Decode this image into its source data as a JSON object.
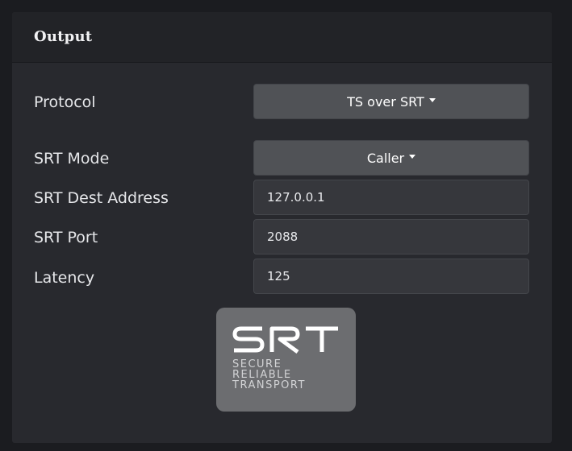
{
  "panel": {
    "title": "Output"
  },
  "fields": {
    "protocol": {
      "label": "Protocol",
      "value": "TS over SRT"
    },
    "srt_mode": {
      "label": "SRT Mode",
      "value": "Caller"
    },
    "dest_address": {
      "label": "SRT Dest Address",
      "value": "127.0.0.1"
    },
    "port": {
      "label": "SRT Port",
      "value": "2088"
    },
    "latency": {
      "label": "Latency",
      "value": "125"
    }
  },
  "logo": {
    "mark": "SRT",
    "tagline": [
      "SECURE",
      "RELIABLE",
      "TRANSPORT"
    ]
  },
  "icons": {
    "dropdown": "caret-down-icon"
  },
  "colors": {
    "background": "#1b1c20",
    "card": "#28292e",
    "button": "#505256",
    "input": "#36373c",
    "logo_bg": "#6c6d70"
  }
}
